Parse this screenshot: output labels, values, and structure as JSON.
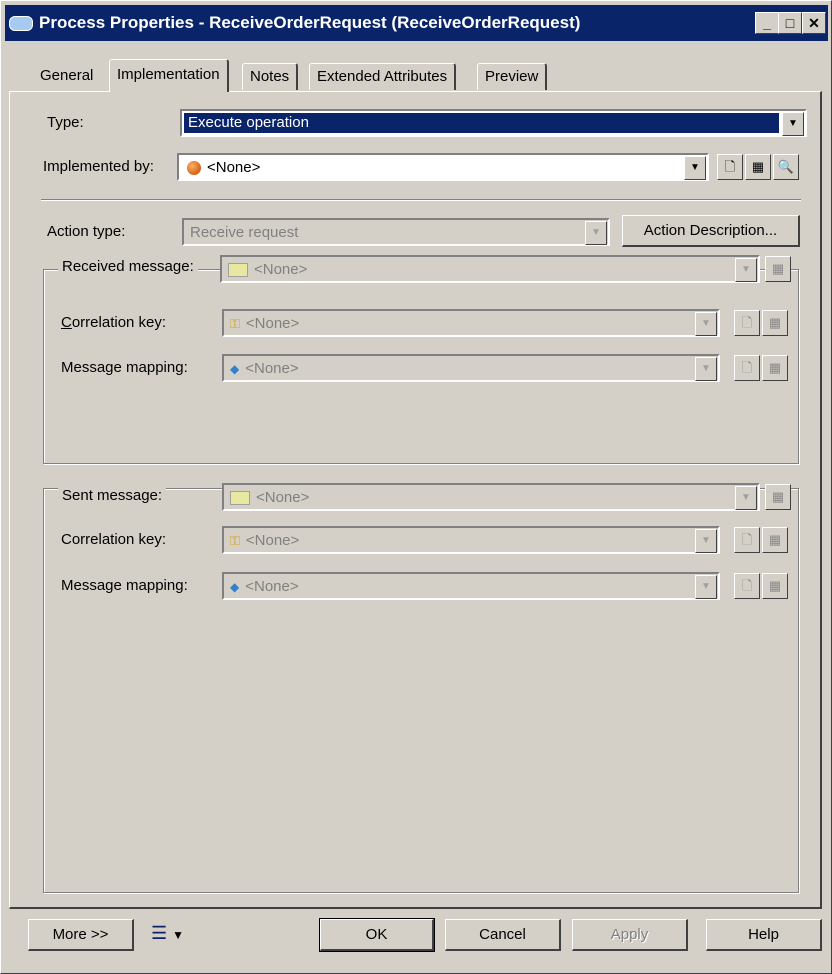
{
  "window": {
    "title": "Process Properties - ReceiveOrderRequest (ReceiveOrderRequest)",
    "min_glyph": "_",
    "max_glyph": "□",
    "close_glyph": "✕"
  },
  "tabs": [
    {
      "label": "General"
    },
    {
      "label": "Implementation"
    },
    {
      "label": "Notes"
    },
    {
      "label": "Extended Attributes"
    },
    {
      "label": "Preview"
    }
  ],
  "form": {
    "type_label": "Type:",
    "type_value": "Execute operation",
    "implemented_by_label": "Implemented by:",
    "implemented_by_value": "<None>",
    "action_type_label": "Action type:",
    "action_type_value": "Receive request",
    "action_description_button": "Action Description..."
  },
  "received_group": {
    "title": "Received message:",
    "message_value": "<None>",
    "correlation_label": "Correlation key:",
    "correlation_value": "<None>",
    "mapping_label": "Message mapping:",
    "mapping_value": "<None>"
  },
  "sent_group": {
    "title": "Sent message:",
    "message_value": "<None>",
    "correlation_label": "Correlation key:",
    "correlation_value": "<None>",
    "mapping_label": "Message mapping:",
    "mapping_value": "<None>"
  },
  "footer": {
    "more_button": "More >>",
    "ok_button": "OK",
    "cancel_button": "Cancel",
    "apply_button": "Apply",
    "help_button": "Help"
  },
  "colors": {
    "dialog_bg": "#d4d0c8",
    "titlebar": "#0a246a",
    "selection": "#0a246a"
  }
}
